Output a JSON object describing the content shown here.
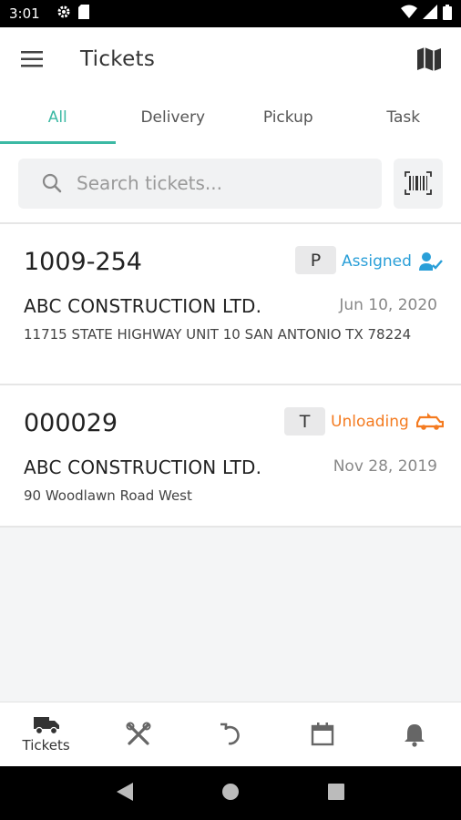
{
  "status_bar": {
    "time": "3:01"
  },
  "app_bar": {
    "title": "Tickets"
  },
  "tabs": [
    {
      "label": "All",
      "active": true
    },
    {
      "label": "Delivery",
      "active": false
    },
    {
      "label": "Pickup",
      "active": false
    },
    {
      "label": "Task",
      "active": false
    }
  ],
  "search": {
    "placeholder": "Search tickets...",
    "value": ""
  },
  "tickets": [
    {
      "number": "1009-254",
      "type": "P",
      "status": "Assigned",
      "status_color": "#2a9fd8",
      "status_icon": "assigned-user-icon",
      "company": "ABC CONSTRUCTION LTD.",
      "date": "Jun 10, 2020",
      "address": "11715 STATE HIGHWAY UNIT 10 SAN ANTONIO TX 78224"
    },
    {
      "number": "000029",
      "type": "T",
      "status": "Unloading",
      "status_color": "#f47b20",
      "status_icon": "unloading-truck-icon",
      "company": "ABC CONSTRUCTION LTD.",
      "date": "Nov 28, 2019",
      "address": "90 Woodlawn Road West"
    }
  ],
  "bottom_nav": [
    {
      "label": "Tickets",
      "icon": "truck-icon",
      "active": true
    },
    {
      "label": "",
      "icon": "tools-icon",
      "active": false
    },
    {
      "label": "",
      "icon": "undo-icon",
      "active": false
    },
    {
      "label": "",
      "icon": "calendar-icon",
      "active": false
    },
    {
      "label": "",
      "icon": "bell-icon",
      "active": false
    }
  ],
  "colors": {
    "accent": "#3cb9a4",
    "assigned": "#2a9fd8",
    "unloading": "#f47b20"
  }
}
